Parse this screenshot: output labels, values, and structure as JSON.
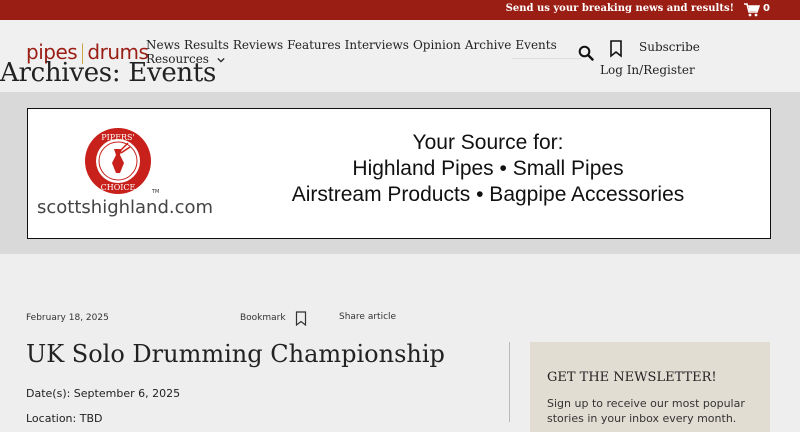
{
  "topbar": {
    "news_link": "Send us your breaking news and results!",
    "cart_count": "0",
    "bg_color": "#9b1e15"
  },
  "header": {
    "logo_left": "pipes",
    "logo_sep": "|",
    "logo_right": "drums",
    "nav": [
      "News",
      "Results",
      "Reviews",
      "Features",
      "Interviews",
      "Opinion",
      "Archive",
      "Events",
      "Resources"
    ],
    "subscribe": "Subscribe",
    "login": "Log In/Register"
  },
  "page": {
    "title": "Archives: Events"
  },
  "ad": {
    "badge_top": "PIPERS'",
    "badge_bottom": "CHOICE",
    "badge_tm": "TM",
    "domain": "scottshighland.com",
    "lines": [
      "Your Source for:",
      "Highland Pipes  • Small Pipes",
      "Airstream Products  •  Bagpipe Accessories"
    ]
  },
  "article": {
    "date": "February 18, 2025",
    "bookmark": "Bookmark",
    "share": "Share article",
    "title": "UK Solo Drumming Championship",
    "dates": "Date(s): September 6, 2025",
    "location": "Location: TBD"
  },
  "newsletter": {
    "title": "GET THE NEWSLETTER!",
    "text": "Sign up to receive our most popular stories in your inbox every month."
  },
  "colors": {
    "accent": "#9b1e15",
    "logo_sep": "#c9a23a",
    "newsletter_bg": "#e2ddd3"
  }
}
